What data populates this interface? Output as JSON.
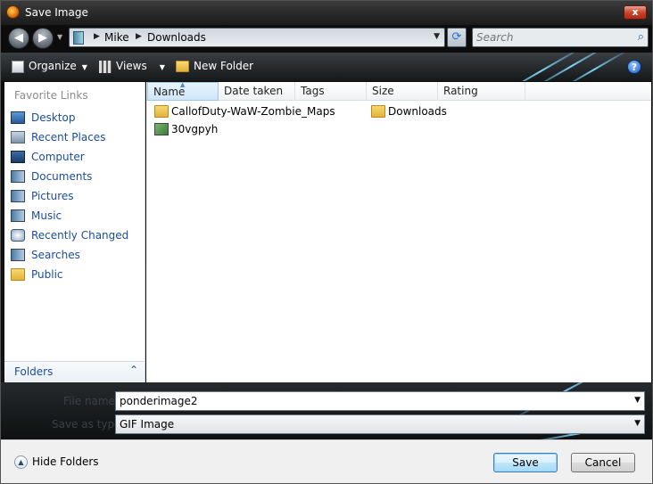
{
  "window": {
    "title": "Save Image",
    "close_label": "x"
  },
  "nav": {
    "back_glyph": "◀",
    "forward_glyph": "▶",
    "breadcrumbs": [
      "Mike",
      "Downloads"
    ],
    "search_placeholder": "Search"
  },
  "toolbar": {
    "organize_label": "Organize",
    "views_label": "Views",
    "new_folder_label": "New Folder",
    "help_label": "?"
  },
  "sidebar": {
    "header": "Favorite Links",
    "items": [
      {
        "label": "Desktop",
        "icon": "desktop-icon"
      },
      {
        "label": "Recent Places",
        "icon": "recent-places-icon"
      },
      {
        "label": "Computer",
        "icon": "computer-icon"
      },
      {
        "label": "Documents",
        "icon": "documents-icon"
      },
      {
        "label": "Pictures",
        "icon": "pictures-icon"
      },
      {
        "label": "Music",
        "icon": "music-icon"
      },
      {
        "label": "Recently Changed",
        "icon": "recently-changed-icon"
      },
      {
        "label": "Searches",
        "icon": "searches-icon"
      },
      {
        "label": "Public",
        "icon": "folder-icon"
      }
    ],
    "folders_label": "Folders"
  },
  "columns": [
    "Name",
    "Date taken",
    "Tags",
    "Size",
    "Rating"
  ],
  "files": [
    {
      "label": "CallofDuty-WaW-Zombie_Maps",
      "type": "folder"
    },
    {
      "label": "Downloads",
      "type": "folder"
    },
    {
      "label": "30vgpyh",
      "type": "image"
    }
  ],
  "form": {
    "filename_label": "File name:",
    "filename_value": "ponderimage2",
    "savetype_label": "Save as type:",
    "savetype_value": "GIF Image"
  },
  "footer": {
    "hide_folders_label": "Hide Folders",
    "save_label": "Save",
    "cancel_label": "Cancel"
  },
  "colors": {
    "link": "#1a4c9c",
    "accent": "#7fd7ff"
  }
}
